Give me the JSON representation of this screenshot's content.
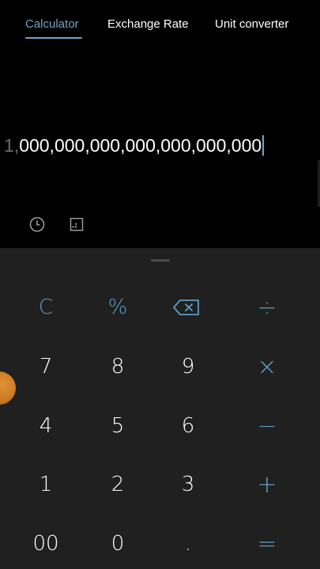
{
  "tabs": [
    {
      "label": "Calculator",
      "active": true
    },
    {
      "label": "Exchange Rate",
      "active": false
    },
    {
      "label": "Unit converter",
      "active": false
    }
  ],
  "display": {
    "value_dim": "1,",
    "value_main": "000,000,000,000,000,000,000",
    "cursor_visible": true
  },
  "tools": {
    "history_icon": "clock-icon",
    "scientific_icon": "scientific-mode-icon"
  },
  "keypad": {
    "clear": "C",
    "percent": "%",
    "backspace_icon": "backspace-icon",
    "divide": "÷",
    "seven": "7",
    "eight": "8",
    "nine": "9",
    "multiply": "×",
    "four": "4",
    "five": "5",
    "six": "6",
    "minus": "−",
    "one": "1",
    "two": "2",
    "three": "3",
    "plus": "+",
    "double_zero": "00",
    "zero": "0",
    "decimal": ".",
    "equals": "="
  },
  "colors": {
    "accent": "#6fa4c8",
    "keypad_bg": "#202020",
    "display_bg": "#000000",
    "floating_ball": "#d4822a"
  }
}
